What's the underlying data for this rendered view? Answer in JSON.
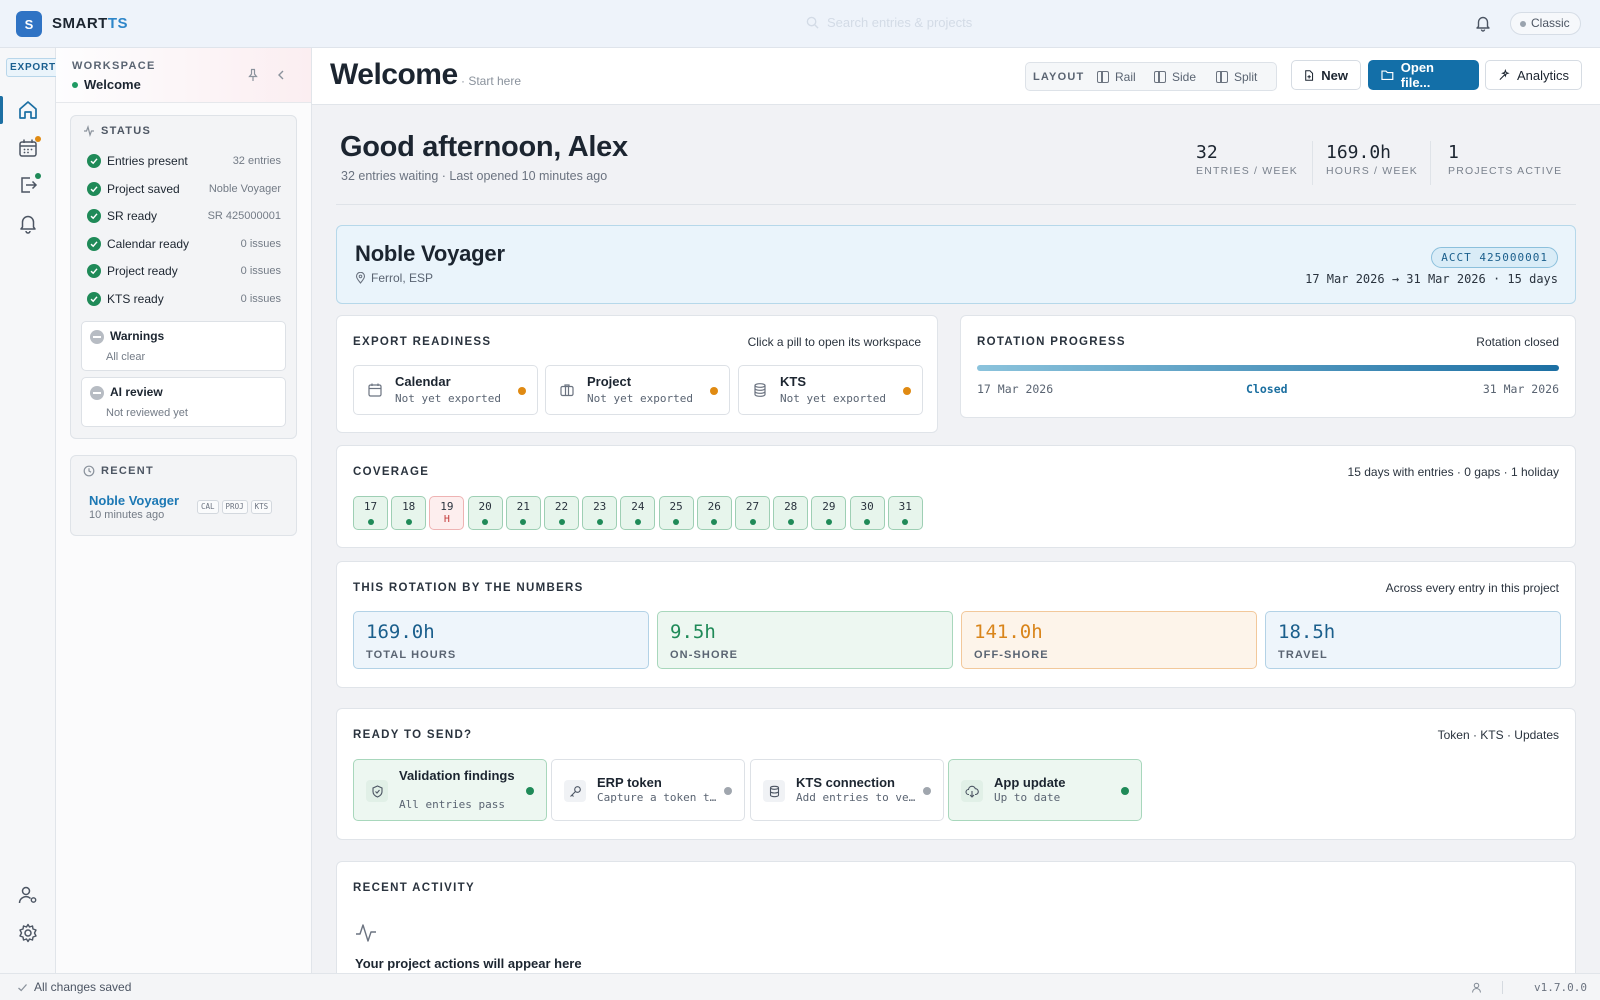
{
  "topbar": {
    "logo_letter": "S",
    "brand_part1": "SMART",
    "brand_part2": "TS",
    "search_hint": "Search entries & projects",
    "mode_label": "Classic"
  },
  "rail": {
    "export_badge": "EXPORT"
  },
  "side": {
    "workspace_label": "WORKSPACE",
    "workspace_name": "Welcome",
    "status": {
      "title": "STATUS",
      "rows": [
        {
          "label": "Entries present",
          "value": "32 entries"
        },
        {
          "label": "Project saved",
          "value": "Noble Voyager"
        },
        {
          "label": "SR ready",
          "value": "SR 425000001"
        },
        {
          "label": "Calendar ready",
          "value": "0 issues"
        },
        {
          "label": "Project ready",
          "value": "0 issues"
        },
        {
          "label": "KTS ready",
          "value": "0 issues"
        }
      ],
      "warnings": {
        "title": "Warnings",
        "detail": "All clear"
      },
      "ai_review": {
        "title": "AI review",
        "detail": "Not reviewed yet"
      }
    },
    "recent": {
      "title": "RECENT",
      "items": [
        {
          "name": "Noble Voyager",
          "time": "10 minutes ago",
          "tags": [
            "CAL",
            "PROJ",
            "KTS"
          ]
        }
      ]
    }
  },
  "header": {
    "title": "Welcome",
    "subtitle": "· Start here",
    "layout_label": "LAYOUT",
    "layout_options": [
      "Rail",
      "Side",
      "Split"
    ],
    "new_label": "New",
    "open_label": "Open file...",
    "analytics_label": "Analytics"
  },
  "greeting": {
    "title": "Good afternoon, Alex",
    "subtitle": "32 entries waiting · Last opened 10 minutes ago",
    "kpis": [
      {
        "value": "32",
        "label": "ENTRIES / WEEK"
      },
      {
        "value": "169.0h",
        "label": "HOURS / WEEK"
      },
      {
        "value": "1",
        "label": "PROJECTS ACTIVE"
      }
    ]
  },
  "project": {
    "name": "Noble Voyager",
    "location": "Ferrol, ESP",
    "account": "ACCT 425000001",
    "dates": "17 Mar 2026 → 31 Mar 2026 · 15 days"
  },
  "export_readiness": {
    "title": "EXPORT READINESS",
    "hint": "Click a pill to open its workspace",
    "pills": [
      {
        "title": "Calendar",
        "detail": "Not yet exported"
      },
      {
        "title": "Project",
        "detail": "Not yet exported"
      },
      {
        "title": "KTS",
        "detail": "Not yet exported"
      }
    ]
  },
  "rotation": {
    "title": "ROTATION PROGRESS",
    "status": "Rotation closed",
    "progress": 1.0,
    "start": "17 Mar 2026",
    "state": "Closed",
    "end": "31 Mar 2026"
  },
  "coverage": {
    "title": "COVERAGE",
    "summary": "15 days with entries · 0 gaps · 1 holiday",
    "days": [
      {
        "n": "17",
        "holiday": false
      },
      {
        "n": "18",
        "holiday": false
      },
      {
        "n": "19",
        "holiday": true,
        "mark": "H"
      },
      {
        "n": "20",
        "holiday": false
      },
      {
        "n": "21",
        "holiday": false
      },
      {
        "n": "22",
        "holiday": false
      },
      {
        "n": "23",
        "holiday": false
      },
      {
        "n": "24",
        "holiday": false
      },
      {
        "n": "25",
        "holiday": false
      },
      {
        "n": "26",
        "holiday": false
      },
      {
        "n": "27",
        "holiday": false
      },
      {
        "n": "28",
        "holiday": false
      },
      {
        "n": "29",
        "holiday": false
      },
      {
        "n": "30",
        "holiday": false
      },
      {
        "n": "31",
        "holiday": false
      }
    ]
  },
  "numbers": {
    "title": "THIS ROTATION BY THE NUMBERS",
    "hint": "Across every entry in this project",
    "boxes": [
      {
        "value": "169.0h",
        "label": "TOTAL HOURS"
      },
      {
        "value": "9.5h",
        "label": "ON-SHORE"
      },
      {
        "value": "141.0h",
        "label": "OFF-SHORE"
      },
      {
        "value": "18.5h",
        "label": "TRAVEL"
      }
    ]
  },
  "ready_to_send": {
    "title": "READY TO SEND?",
    "hint": "Token · KTS · Updates",
    "items": [
      {
        "title": "Validation findings",
        "detail": "All entries pass"
      },
      {
        "title": "ERP token",
        "detail": "Capture a token to send"
      },
      {
        "title": "KTS connection",
        "detail": "Add entries to verify"
      },
      {
        "title": "App update",
        "detail": "Up to date"
      }
    ]
  },
  "activity": {
    "title": "RECENT ACTIVITY",
    "empty": "Your project actions will appear here"
  },
  "statusbar": {
    "saved": "All changes saved",
    "version": "v1.7.0.0"
  },
  "colors": {
    "accent": "#136fa8",
    "ok": "#1f8a58",
    "pending": "#e08a12",
    "holiday": "#c43d3d"
  }
}
